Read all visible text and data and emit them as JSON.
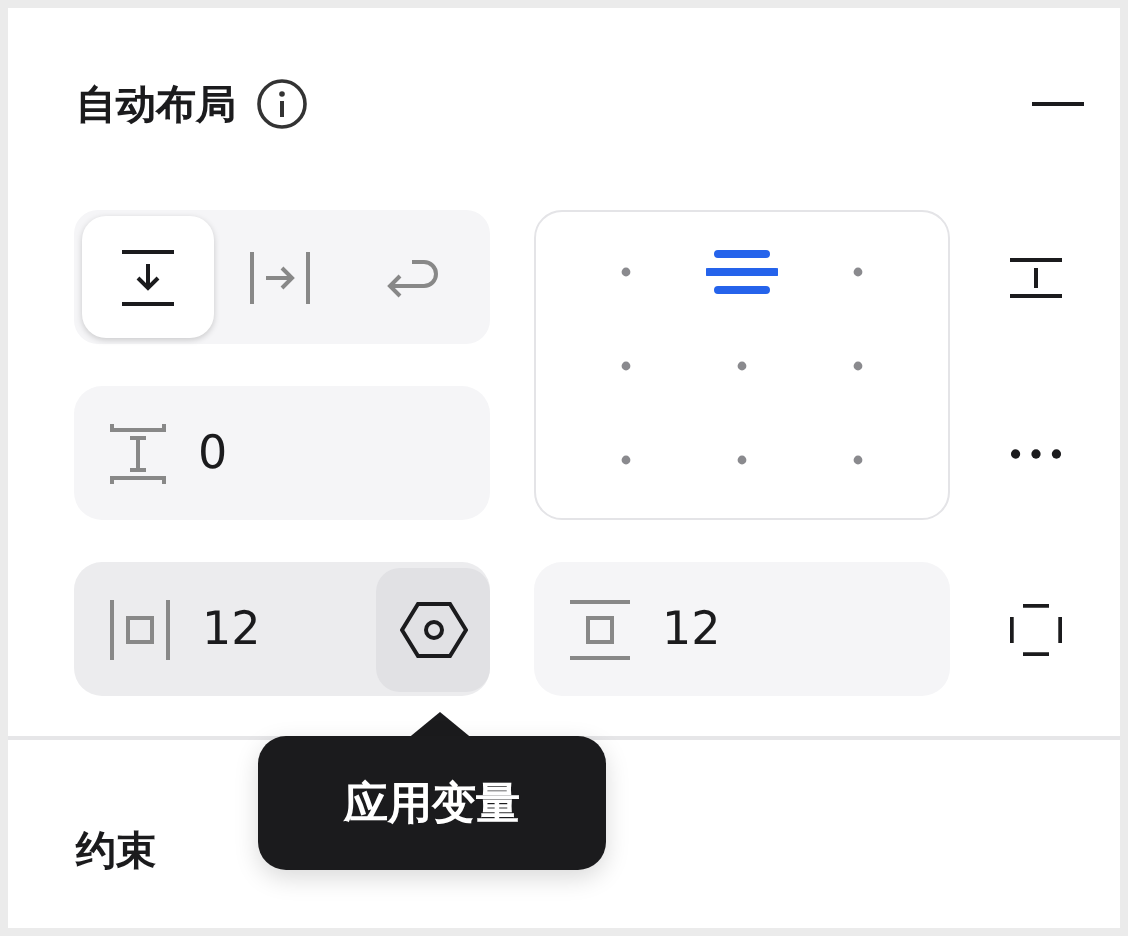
{
  "panel": {
    "title": "自动布局"
  },
  "directions": [
    {
      "kind": "vertical",
      "selected": true
    },
    {
      "kind": "horizontal",
      "selected": false
    },
    {
      "kind": "wrap",
      "selected": false
    }
  ],
  "alignment": [
    {
      "selected": false
    },
    {
      "selected": true
    },
    {
      "selected": false
    },
    {
      "selected": false
    },
    {
      "selected": false
    },
    {
      "selected": false
    },
    {
      "selected": false
    },
    {
      "selected": false
    },
    {
      "selected": false
    }
  ],
  "gap": {
    "value": "0"
  },
  "padding_horizontal": {
    "value": "12"
  },
  "padding_vertical": {
    "value": "12"
  },
  "tooltip": {
    "text": "应用变量"
  },
  "next_section": {
    "title": "约束"
  }
}
